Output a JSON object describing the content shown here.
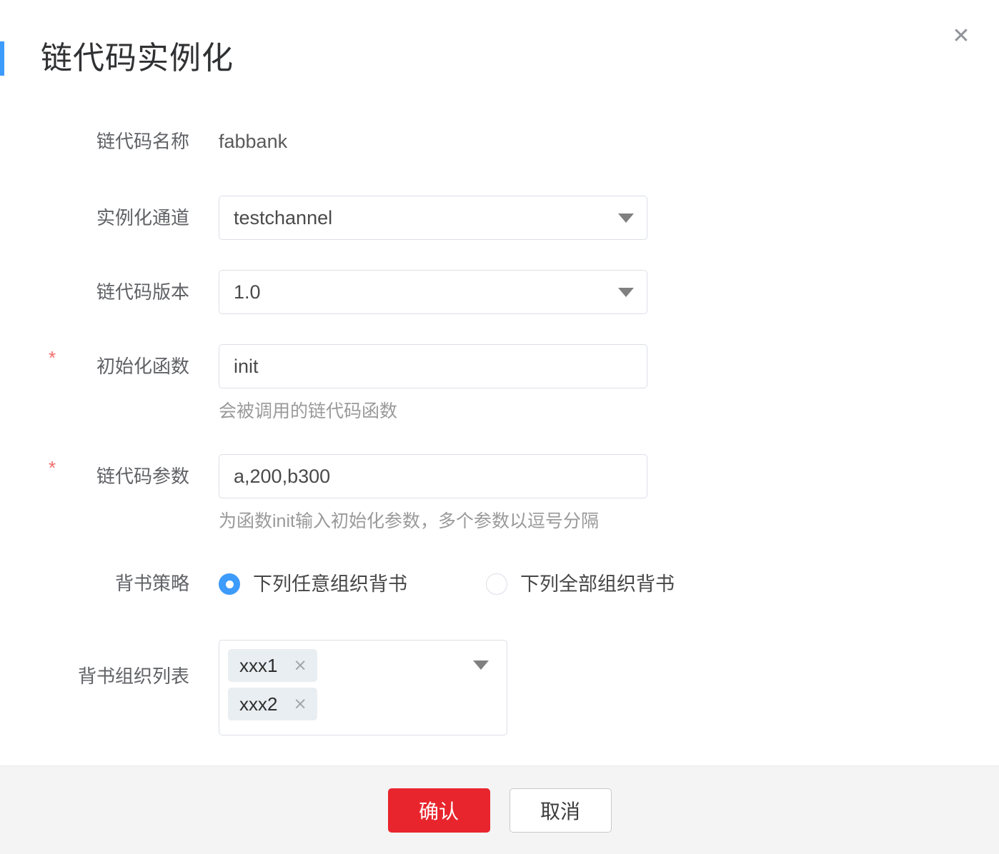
{
  "dialog": {
    "title": "链代码实例化",
    "close_icon": "close-icon",
    "accent_color": "#3d9bfb"
  },
  "form": {
    "rows": [
      {
        "label": "链代码名称",
        "required": false,
        "type": "static",
        "value": "fabbank"
      },
      {
        "label": "实例化通道",
        "required": false,
        "type": "select",
        "value": "testchannel"
      },
      {
        "label": "链代码版本",
        "required": false,
        "type": "select",
        "value": "1.0"
      },
      {
        "label": "初始化函数",
        "required": true,
        "required_mark": "*",
        "type": "input",
        "value": "init",
        "hint": "会被调用的链代码函数"
      },
      {
        "label": "链代码参数",
        "required": true,
        "required_mark": "*",
        "type": "input",
        "value": "a,200,b300",
        "hint": "为函数init输入初始化参数，多个参数以逗号分隔"
      },
      {
        "label": "背书策略",
        "required": false,
        "type": "radio"
      },
      {
        "label": "背书组织列表",
        "required": false,
        "type": "tags"
      }
    ],
    "endorsement_policy": {
      "options": [
        {
          "label": "下列任意组织背书",
          "selected": true
        },
        {
          "label": "下列全部组织背书",
          "selected": false
        }
      ]
    },
    "endorsement_orgs": {
      "tags": [
        {
          "label": "xxx1",
          "remove_icon": "×"
        },
        {
          "label": "xxx2",
          "remove_icon": "×"
        }
      ]
    }
  },
  "footer": {
    "confirm_label": "确认",
    "cancel_label": "取消",
    "confirm_color": "#e8252d"
  }
}
